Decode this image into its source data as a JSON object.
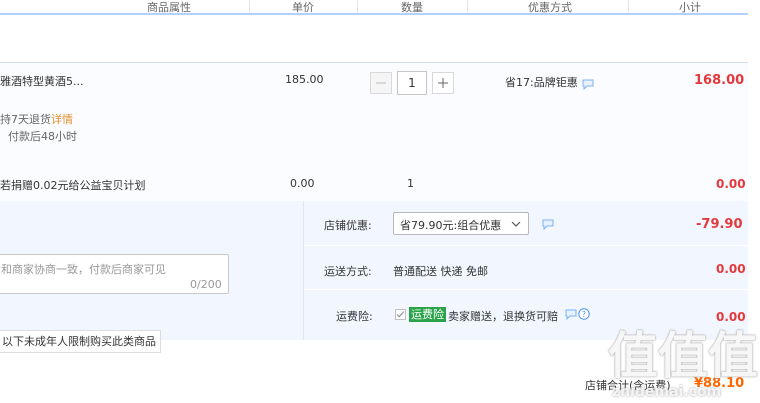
{
  "header": {
    "col_attributes": "商品属性",
    "col_price": "单价",
    "col_quantity": "数量",
    "col_discount": "优惠方式",
    "col_subtotal": "小计"
  },
  "item": {
    "title": "雅酒特型黄酒5...",
    "price": "185.00",
    "quantity": "1",
    "discount": "省17:品牌钜惠",
    "subtotal": "168.00",
    "return_policy": "持7天退货",
    "details_link": "详情",
    "ship_time": "付款后48小时"
  },
  "charity": {
    "label": "若捐赠0.02元给公益宝贝计划",
    "price": "0.00",
    "quantity": "1",
    "subtotal": "0.00"
  },
  "summary": {
    "store_discount_label": "店铺优惠:",
    "store_discount_value": "省79.90元:组合优惠",
    "store_discount_amount": "-79.90",
    "shipping_label": "运送方式:",
    "shipping_value": "普通配送 快递 免邮",
    "shipping_amount": "0.00",
    "insurance_label": "运费险:",
    "insurance_badge": "运费险",
    "insurance_text": "卖家赠送，退换货可赔",
    "insurance_amount": "0.00"
  },
  "message": {
    "placeholder": "和商家协商一致，付款后商家可见",
    "counter": "0/200"
  },
  "age_notice": "以下未成年人限制购买此类商品",
  "store_total_label": "店铺合计(含运费)",
  "store_total_value": "¥88.10",
  "watermark": {
    "text": "值值值",
    "site": "zhidemai.com"
  },
  "colors": {
    "accent_red": "#e4393c",
    "header_line": "#b2d1ff",
    "summary_bg": "#f2f7ff",
    "badge_green": "#2aa34a"
  }
}
